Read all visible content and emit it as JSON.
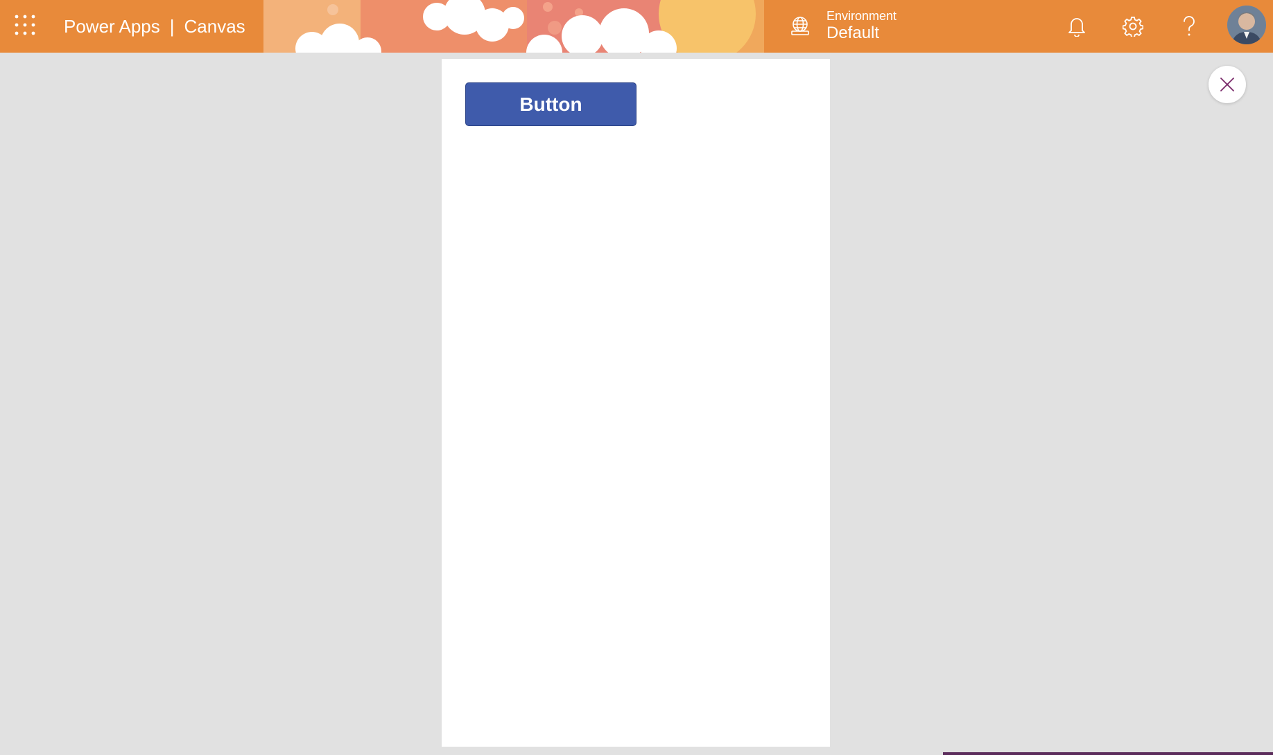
{
  "header": {
    "product_name": "Power Apps",
    "separator": "|",
    "mode": "Canvas",
    "environment_label": "Environment",
    "environment_value": "Default",
    "icons": [
      "waffle-icon",
      "globe-icon",
      "bell-icon",
      "gear-icon",
      "help-icon"
    ],
    "colors": {
      "banner": "#e88a3a",
      "text": "#ffffff"
    }
  },
  "app": {
    "button_label": "Button",
    "colors": {
      "button_fill": "#3f5bab",
      "screen": "#ffffff",
      "backdrop": "#e1e1e1"
    }
  },
  "close": {
    "icon": "close-icon",
    "color": "#7a2a6a"
  }
}
